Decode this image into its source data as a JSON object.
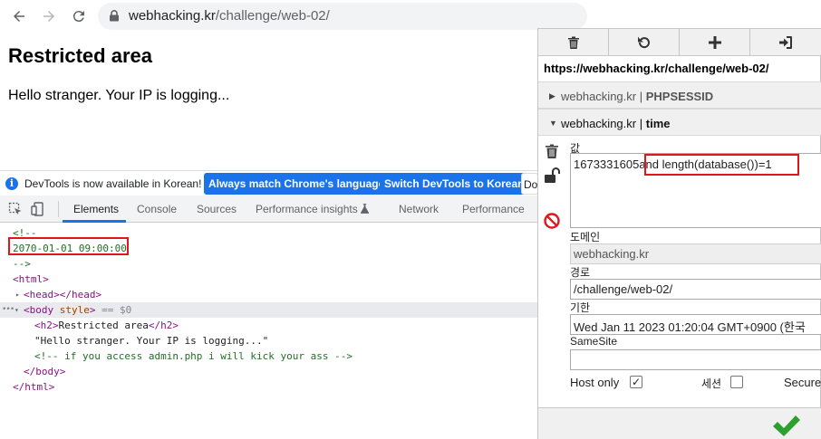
{
  "browser": {
    "url_host": "webhacking.kr",
    "url_path": "/challenge/web-02/"
  },
  "page": {
    "title": "Restricted area",
    "text": "Hello stranger. Your IP is logging..."
  },
  "devtools": {
    "infobar": {
      "message": "DevTools is now available in Korean!",
      "btn_match": "Always match Chrome's language",
      "btn_switch": "Switch DevTools to Korean",
      "btn_dont": "Do"
    },
    "tabs": [
      "Elements",
      "Console",
      "Sources",
      "Performance insights",
      "Network",
      "Performance"
    ],
    "active_tab": "Elements",
    "dom": {
      "comment_open": "<!--",
      "comment_date": "2070-01-01 09:00:00",
      "comment_close": "-->",
      "html_open": "<html>",
      "head": "<head></head>",
      "body_open_tag": "<body",
      "body_attr": "style",
      "body_close_bracket": ">",
      "body_eq": "== $0",
      "h2_open": "<h2>",
      "h2_text": "Restricted area",
      "h2_close": "</h2>",
      "text_node": "\"Hello stranger. Your IP is logging...\"",
      "hidden_comment": "<!-- if you access admin.php i will kick your ass -->",
      "body_close": "</body>",
      "html_close": "</html>",
      "dots": "•••"
    }
  },
  "cookie_editor": {
    "url": "https://webhacking.kr/challenge/web-02/",
    "cookies": [
      {
        "domain": "webhacking.kr",
        "name": "PHPSESSID"
      },
      {
        "domain": "webhacking.kr",
        "name": "time"
      }
    ],
    "separator": "|",
    "value_label": "값",
    "value_prefix": "1673331605",
    "value_injection": "and length(database())=1",
    "domain_label": "도메인",
    "domain_value": "webhacking.kr",
    "path_label": "경로",
    "path_value": "/challenge/web-02/",
    "expires_label": "기한",
    "expires_value": "Wed Jan 11 2023 01:20:04 GMT+0900 (한국",
    "samesite_label": "SameSite",
    "samesite_value": "",
    "host_only_label": "Host only",
    "host_only_checked": "✓",
    "session_label": "세션",
    "secure_label": "Secure"
  },
  "colors": {
    "highlight_box": "#e0161c",
    "accent": "#1a73e8",
    "confirm": "#2ca02c"
  }
}
